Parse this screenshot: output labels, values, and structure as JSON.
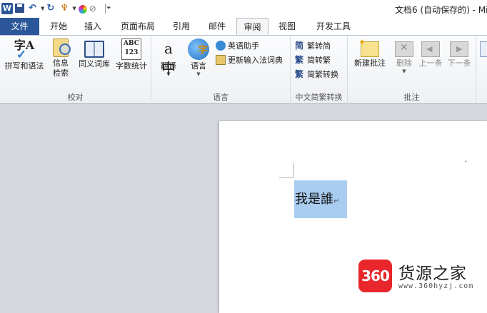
{
  "titlebar": {
    "title": "文档6 (自动保存的) - Mi",
    "word_icon_letter": "W"
  },
  "tabs": {
    "file": "文件",
    "items": [
      "开始",
      "插入",
      "页面布局",
      "引用",
      "邮件",
      "审阅",
      "视图",
      "开发工具"
    ],
    "active": "审阅"
  },
  "ribbon": {
    "groups": {
      "proofing": {
        "label": "校对",
        "spelling": "拼写和语法",
        "research_l1": "信息",
        "research_l2": "检索",
        "thesaurus": "同义词库",
        "word_count": "字数统计",
        "abc_top": "ABC",
        "abc_bottom": "123",
        "spell_glyph": "字A"
      },
      "language": {
        "label": "语言",
        "translate": "翻译",
        "language": "语言",
        "english_assistant": "英语助手",
        "update_ime_dict": "更新输入法词典",
        "translate_glyph": "a中"
      },
      "chinese_conversion": {
        "label": "中文简繁转换",
        "to_simplified": "繁转简",
        "to_traditional": "简转繁",
        "conversion": "简繁转换",
        "glyph_simplified": "简",
        "glyph_traditional": "繁",
        "glyph_conversion": "繁"
      },
      "comments": {
        "label": "批注",
        "new_comment": "新建批注",
        "delete": "删除",
        "previous": "上一条",
        "next": "下一条"
      }
    }
  },
  "document": {
    "selected_text": "我是誰",
    "paragraph_mark": "↵"
  },
  "watermark": {
    "badge": "360",
    "name": "货源之家",
    "url": "www.360hyzj.com"
  },
  "colors": {
    "file_tab": "#2b579a",
    "selection": "#a9cdf0",
    "watermark_red": "#e8262b"
  }
}
